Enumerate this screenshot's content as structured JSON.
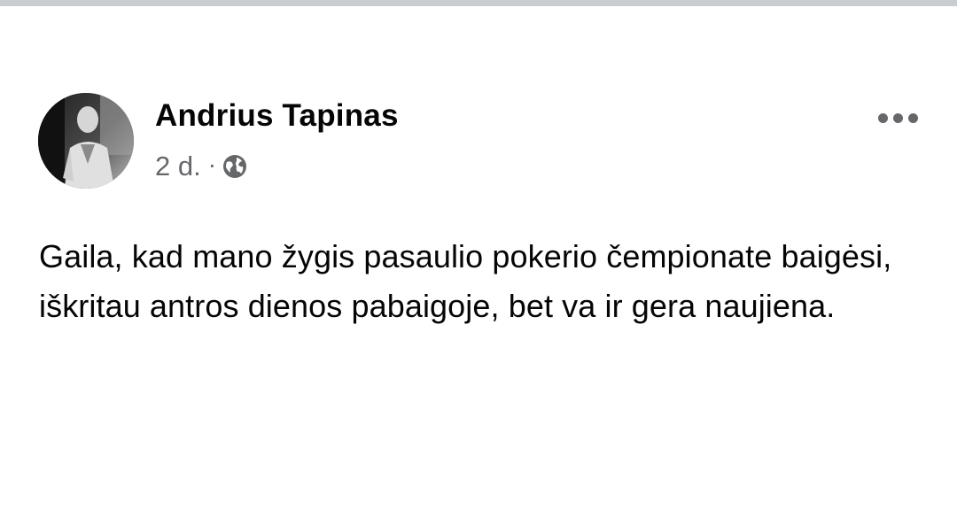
{
  "post": {
    "author": "Andrius Tapinas",
    "timestamp": "2 d.",
    "separator": "·",
    "audience_icon": "globe-icon",
    "more_icon": "more-horizontal-icon",
    "text": "Gaila, kad mano žygis pasaulio pokerio čempionate baigėsi, iškritau antros dienos pabaigoje, bet va ir gera naujiena."
  },
  "colors": {
    "name": "#050505",
    "meta": "#65676b",
    "top_strip": "#c9ccd1",
    "background": "#ffffff"
  }
}
